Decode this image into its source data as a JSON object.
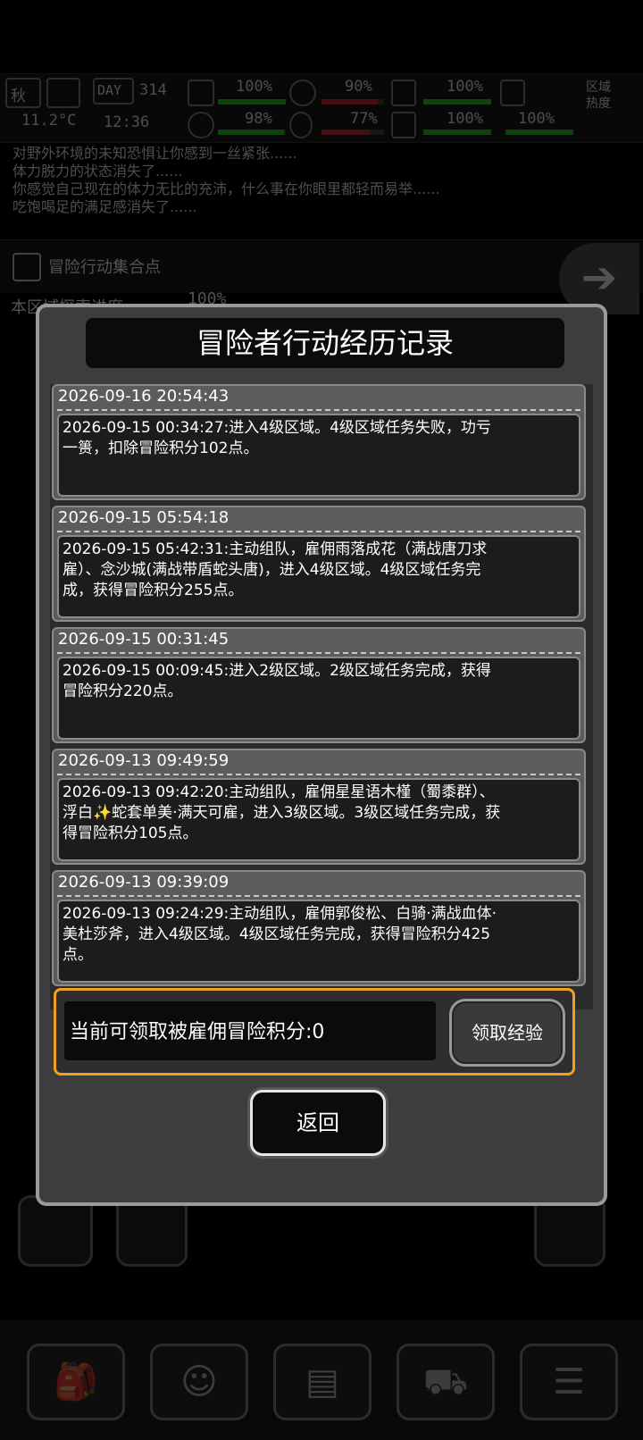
{
  "status_bar": {
    "season": "秋",
    "day_label": "DAY",
    "day_number": "314",
    "temperature": "11.2°C",
    "clock": "12:36",
    "stats": [
      {
        "name": "health-kit",
        "value": "100%"
      },
      {
        "name": "hunger",
        "value": "90%"
      },
      {
        "name": "armor",
        "value": "100%"
      },
      {
        "name": "brain",
        "value": "98%"
      },
      {
        "name": "water",
        "value": "77%"
      },
      {
        "name": "heart",
        "value": "100%"
      },
      {
        "name": "stamina",
        "value": "100%"
      }
    ],
    "zone_heat_label": "区域\n热度"
  },
  "log_lines": [
    "对野外环境的未知恐惧让你感到一丝紧张......",
    "体力脱力的状态消失了......",
    "你感觉自己现在的体力无比的充沛，什么事在你眼里都轻而易举......",
    "吃饱喝足的满足感消失了......"
  ],
  "location": {
    "name": "冒险行动集合点",
    "explore_label": "本区域探索进度",
    "explore_value": "100%"
  },
  "modal": {
    "title": "冒险者行动经历记录",
    "records": [
      {
        "date": "2026-09-16 20:54:43",
        "text": "2026-09-15 00:34:27:进入4级区域。4级区域任务失败，功亏一篑，扣除冒险积分102点。"
      },
      {
        "date": "2026-09-15 05:54:18",
        "text": "2026-09-15 05:42:31:主动组队，雇佣雨落成花（满战唐刀求雇）、念沙城(满战带盾蛇头唐)，进入4级区域。4级区域任务完成，获得冒险积分255点。"
      },
      {
        "date": "2026-09-15 00:31:45",
        "text": "2026-09-15 00:09:45:进入2级区域。2级区域任务完成，获得冒险积分220点。"
      },
      {
        "date": "2026-09-13 09:49:59",
        "text": "2026-09-13 09:42:20:主动组队，雇佣星星语木槿（蜀黍群）、浮白✨蛇套单美·满天可雇，进入3级区域。3级区域任务完成，获得冒险积分105点。"
      },
      {
        "date": "2026-09-13 09:39:09",
        "text": "2026-09-13 09:24:29:主动组队，雇佣郭俊松、白骑·满战血体·美杜莎斧，进入4级区域。4级区域任务完成，获得冒险积分425点。"
      }
    ],
    "claim_text": "当前可领取被雇佣冒险积分:0",
    "claim_button": "领取经验",
    "back_button": "返回"
  },
  "colors": {
    "modal_bg": "#3d3d3d",
    "claim_border": "#f0a020"
  }
}
